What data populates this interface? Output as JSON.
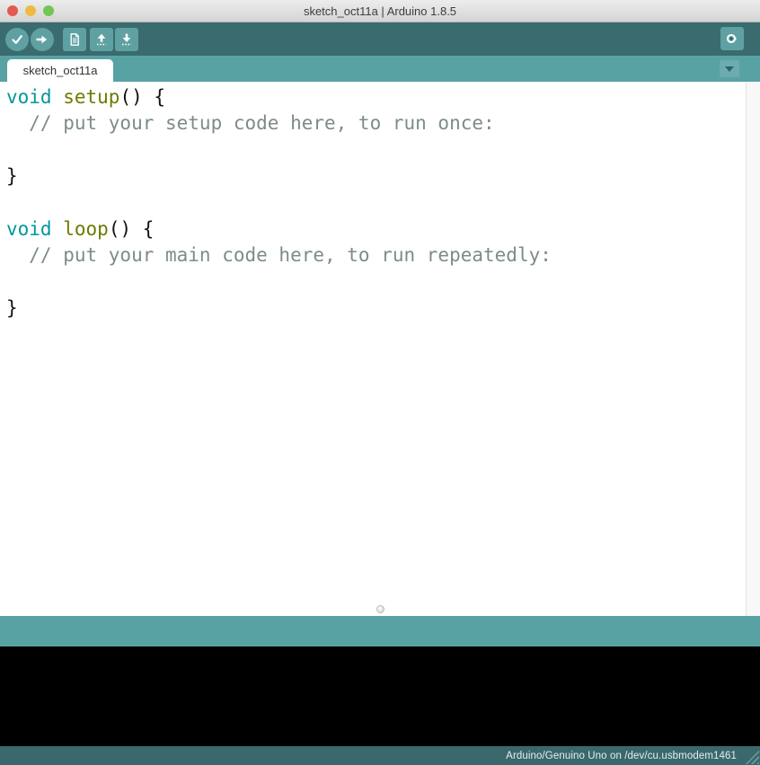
{
  "window": {
    "title": "sketch_oct11a | Arduino 1.8.5"
  },
  "toolbar": {
    "buttons": [
      {
        "id": "verify",
        "icon": "check-icon"
      },
      {
        "id": "upload",
        "icon": "arrow-right-icon"
      },
      {
        "id": "new-sketch",
        "icon": "document-icon"
      },
      {
        "id": "open",
        "icon": "arrow-up-icon"
      },
      {
        "id": "save",
        "icon": "arrow-down-icon"
      },
      {
        "id": "serial-monitor",
        "icon": "magnifier-icon"
      }
    ]
  },
  "tab_bar": {
    "tabs": [
      {
        "label": "sketch_oct11a",
        "active": true
      }
    ],
    "menu_button_icon": "chevron-down-icon"
  },
  "editor": {
    "lines": [
      [
        {
          "t": "void",
          "s": "keyword"
        },
        {
          "t": " ",
          "s": "plain"
        },
        {
          "t": "setup",
          "s": "function"
        },
        {
          "t": "() {",
          "s": "plain"
        }
      ],
      [
        {
          "t": "  // put your setup code here, to run once:",
          "s": "comment"
        }
      ],
      [],
      [
        {
          "t": "}",
          "s": "plain"
        }
      ],
      [],
      [
        {
          "t": "void",
          "s": "keyword"
        },
        {
          "t": " ",
          "s": "plain"
        },
        {
          "t": "loop",
          "s": "function"
        },
        {
          "t": "() {",
          "s": "plain"
        }
      ],
      [
        {
          "t": "  // put your main code here, to run repeatedly:",
          "s": "comment"
        }
      ],
      [],
      [
        {
          "t": "}",
          "s": "plain"
        }
      ]
    ]
  },
  "status_bar": {
    "board_info": "Arduino/Genuino Uno on /dev/cu.usbmodem1461"
  },
  "colors": {
    "toolbar_bg": "#3a6b6e",
    "button_fill": "#5fa0a3",
    "tab_strip_bg": "#58a2a4",
    "status_strip_bg": "#58a2a4",
    "console_bg": "#000000",
    "bottom_bar_bg": "#3b686c",
    "kw": "#00979c",
    "fn": "#6e7a00",
    "cm": "#7e8b8b",
    "pl": "#121212",
    "traffic_red": "#e25a50",
    "traffic_yellow": "#eeba45",
    "traffic_green": "#72c653"
  }
}
